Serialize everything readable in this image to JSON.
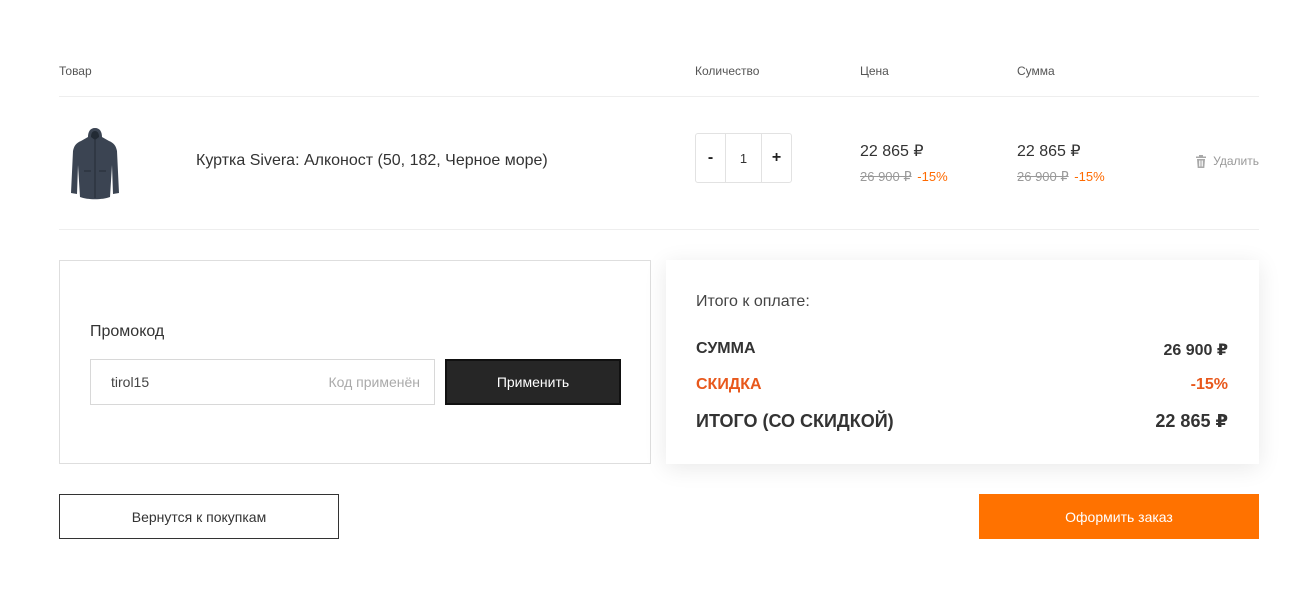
{
  "table_header": {
    "product": "Товар",
    "quantity": "Количество",
    "price": "Цена",
    "sum": "Сумма"
  },
  "cart_items": [
    {
      "image_icon": "jacket-image",
      "name": "Куртка Sivera: Алконост (50, 182, Черное море)",
      "quantity": "1",
      "decrement_label": "-",
      "increment_label": "+",
      "price": "22 865 ₽",
      "price_old": "26 900 ₽",
      "price_discount": "-15%",
      "sum": "22 865 ₽",
      "sum_old": "26 900 ₽",
      "sum_discount": "-15%",
      "delete_label": "Удалить",
      "delete_icon": "trash-icon"
    }
  ],
  "promo": {
    "title": "Промокод",
    "value": "tirol15",
    "status": "Код применён",
    "apply_label": "Применить"
  },
  "summary": {
    "title": "Итого к оплате:",
    "sum_label": "СУММА",
    "sum_value": "26 900 ₽",
    "discount_label": "СКИДКА",
    "discount_value": "-15%",
    "total_label": "ИТОГО (СО СКИДКОЙ)",
    "total_value": "22 865 ₽"
  },
  "actions": {
    "back_label": "Вернутся к покупкам",
    "checkout_label": "Оформить заказ"
  },
  "colors": {
    "accent": "#ff7200",
    "discount": "#e8581c",
    "dark_button": "#262626"
  }
}
